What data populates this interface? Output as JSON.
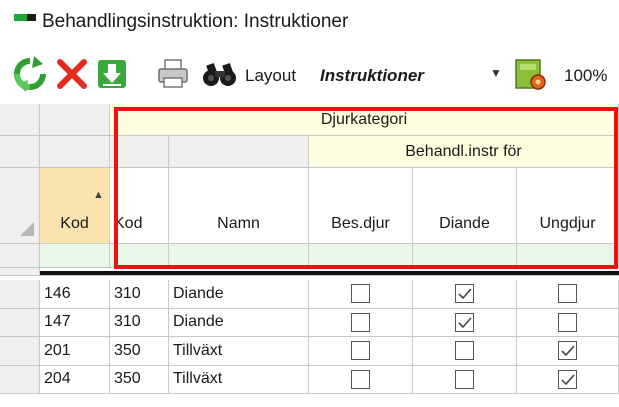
{
  "window": {
    "title": "Behandlingsinstruktion: Instruktioner"
  },
  "toolbar": {
    "refresh_icon": "refresh-icon",
    "delete_icon": "delete-icon",
    "export_icon": "download-icon",
    "print_icon": "print-icon",
    "find_icon": "binoculars-icon",
    "layout_label": "Layout",
    "layout_value": "Instruktioner",
    "layout_settings_icon": "layout-settings-icon",
    "zoom": "100%"
  },
  "grid": {
    "group_header": "Djurkategori",
    "subgroup_header": "Behandl.instr för",
    "columns": {
      "kod1": "Kod",
      "kod2": "Kod",
      "namn": "Namn",
      "bes_djur": "Bes.djur",
      "diande": "Diande",
      "ungdjur": "Ungdjur"
    },
    "sort_indicator": "▲",
    "rows": [
      {
        "kod1": "146",
        "kod2": "310",
        "namn": "Diande",
        "bes_djur": false,
        "diande": true,
        "ungdjur": false
      },
      {
        "kod1": "147",
        "kod2": "310",
        "namn": "Diande",
        "bes_djur": false,
        "diande": true,
        "ungdjur": false
      },
      {
        "kod1": "201",
        "kod2": "350",
        "namn": "Tillväxt",
        "bes_djur": false,
        "diande": false,
        "ungdjur": true
      },
      {
        "kod1": "204",
        "kod2": "350",
        "namn": "Tillväxt",
        "bes_djur": false,
        "diande": false,
        "ungdjur": true
      }
    ]
  },
  "colors": {
    "highlight_frame": "#ee1111",
    "group_header_bg": "#fdfde0",
    "filter_row_bg": "#e8f8e8",
    "sort_column_bg": "#fbe3b0"
  }
}
